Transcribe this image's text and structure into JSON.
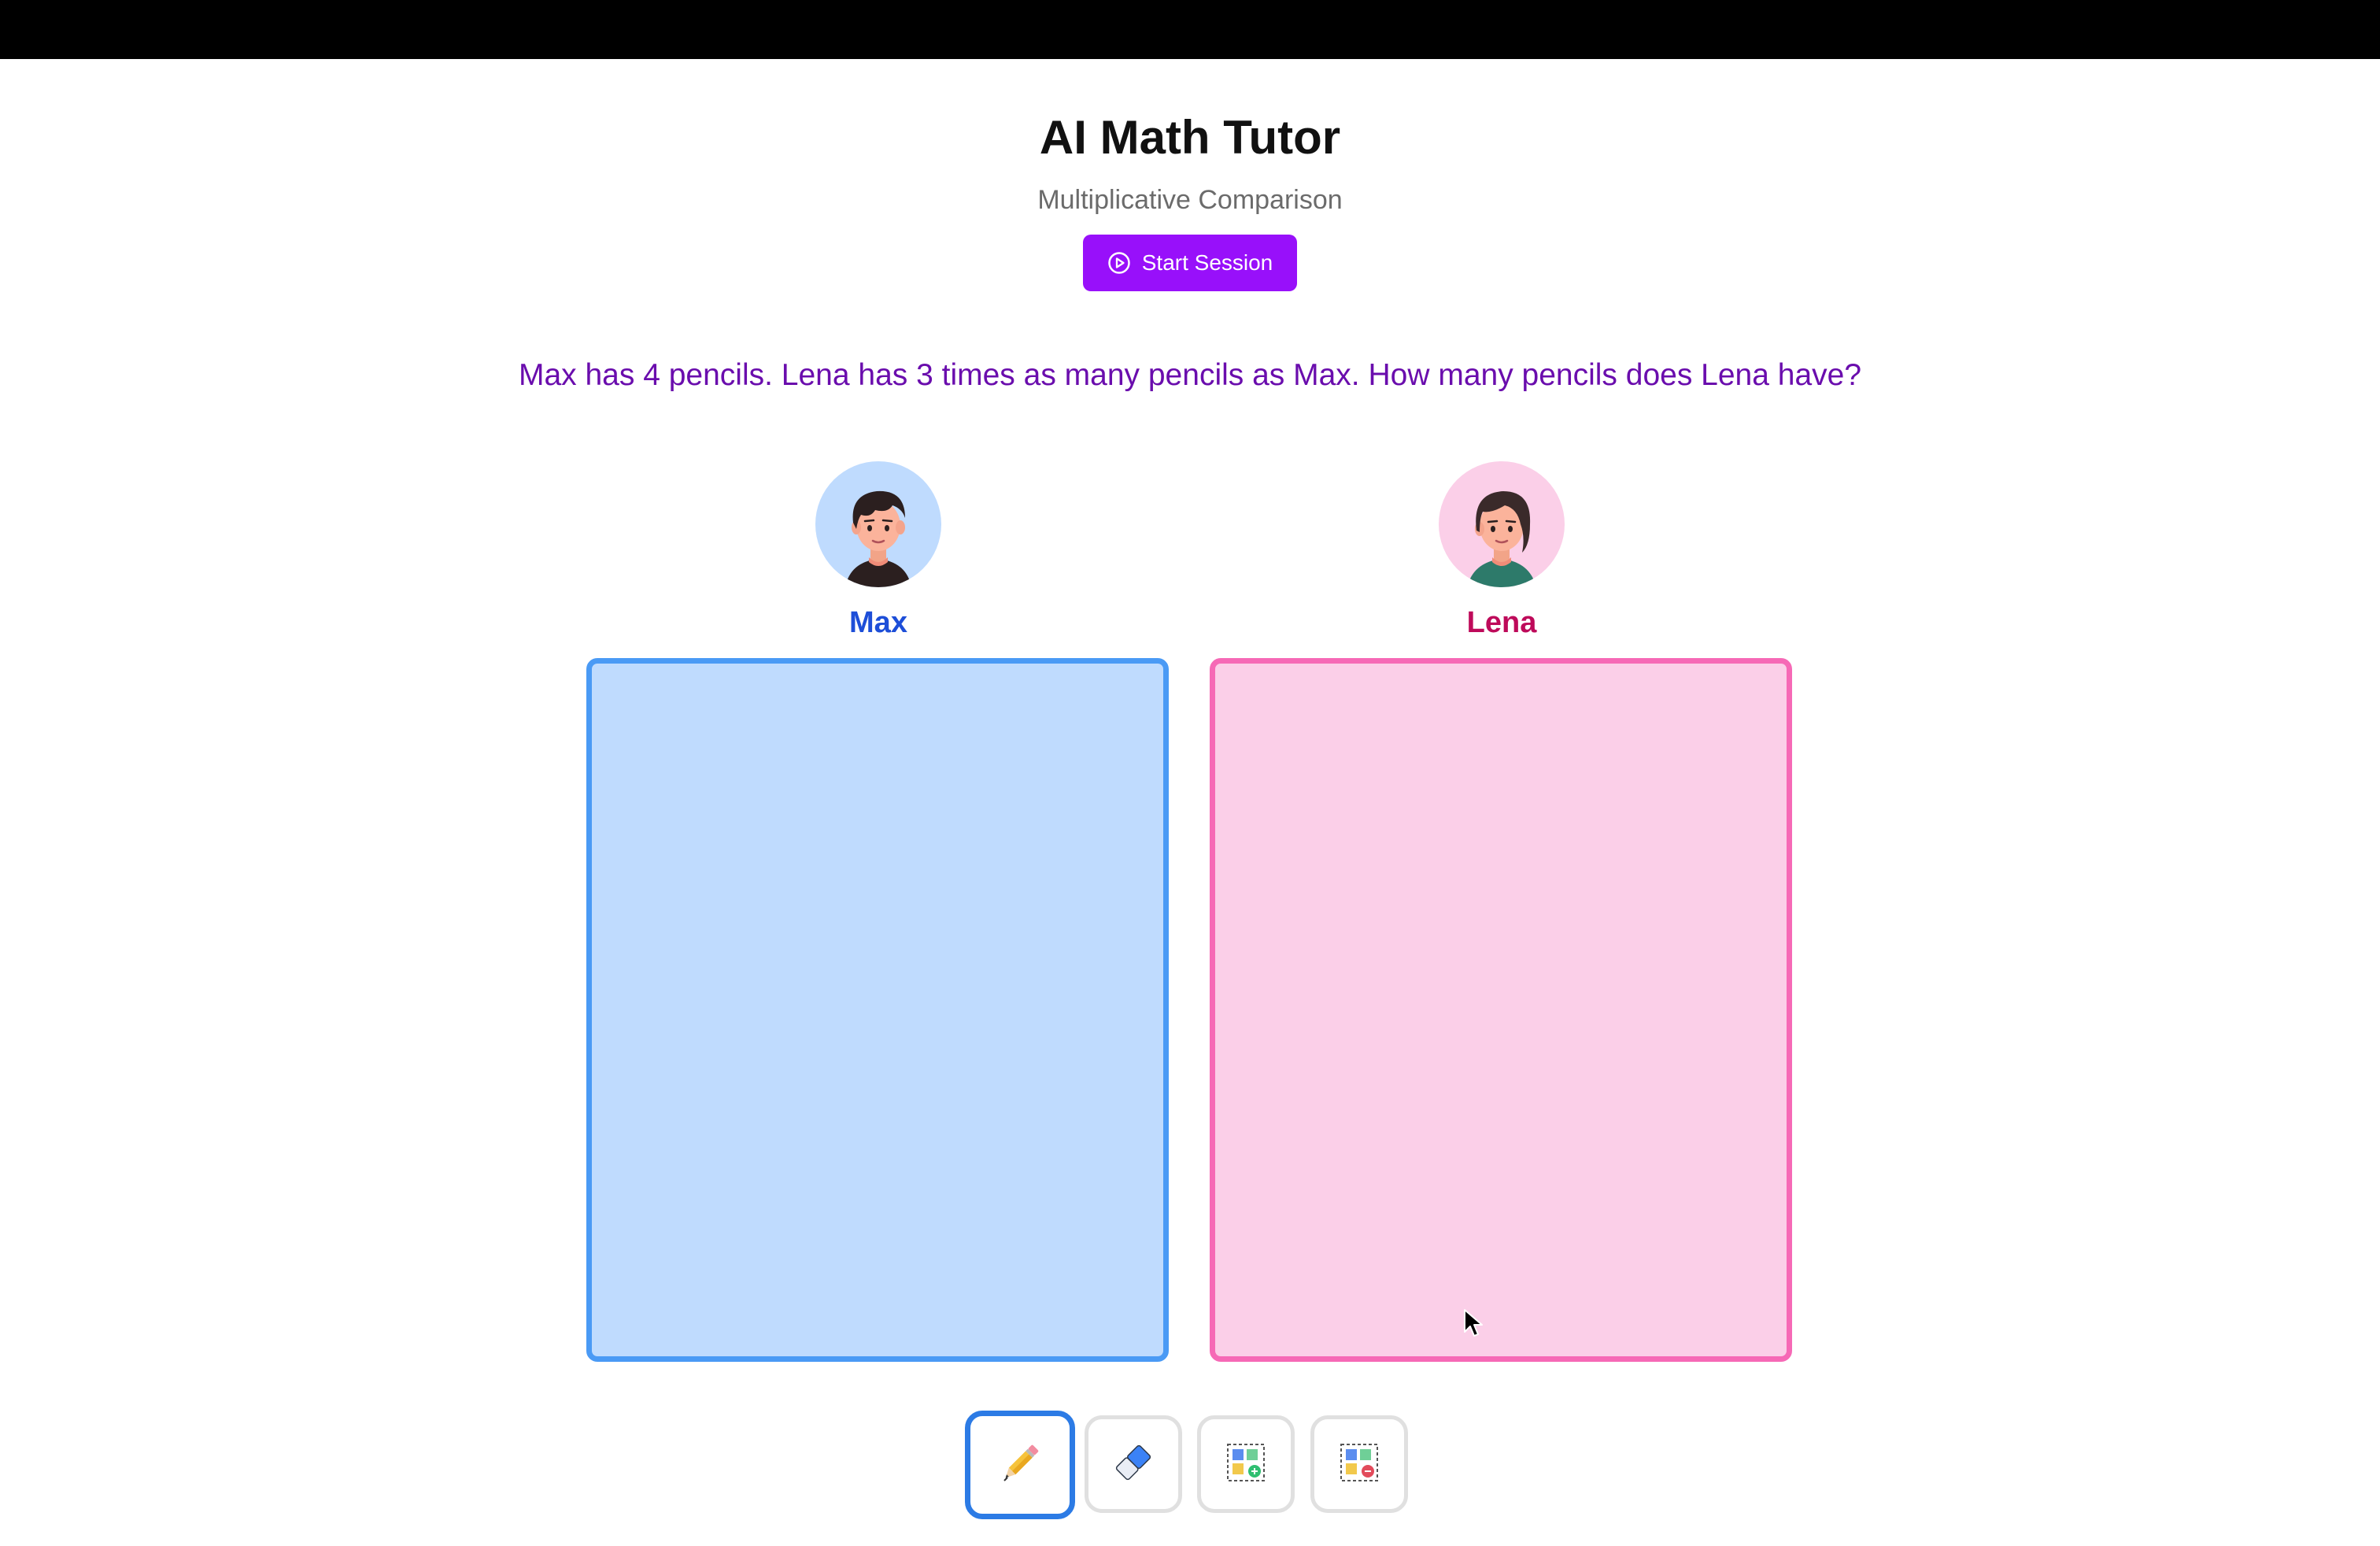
{
  "header": {
    "title": "AI Math Tutor",
    "subtitle": "Multiplicative Comparison",
    "start_button_label": "Start Session"
  },
  "problem": {
    "text": "Max has 4 pencils. Lena has 3 times as many pencils as Max. How many pencils does Lena have?"
  },
  "characters": [
    {
      "name": "Max",
      "color": "#1d4ed8",
      "panel_color": "#bfdbfe",
      "panel_border": "#4a9af5"
    },
    {
      "name": "Lena",
      "color": "#be0a5a",
      "panel_color": "#fbcfe8",
      "panel_border": "#f669b6"
    }
  ],
  "toolbar": {
    "tools": [
      {
        "icon": "pencil-icon",
        "active": true
      },
      {
        "icon": "eraser-icon",
        "active": false
      },
      {
        "icon": "add-group-icon",
        "active": false
      },
      {
        "icon": "remove-group-icon",
        "active": false
      }
    ]
  },
  "colors": {
    "accent": "#9810fa",
    "problem_text": "#6a0dad",
    "active_tool_border": "#2c7be5"
  }
}
